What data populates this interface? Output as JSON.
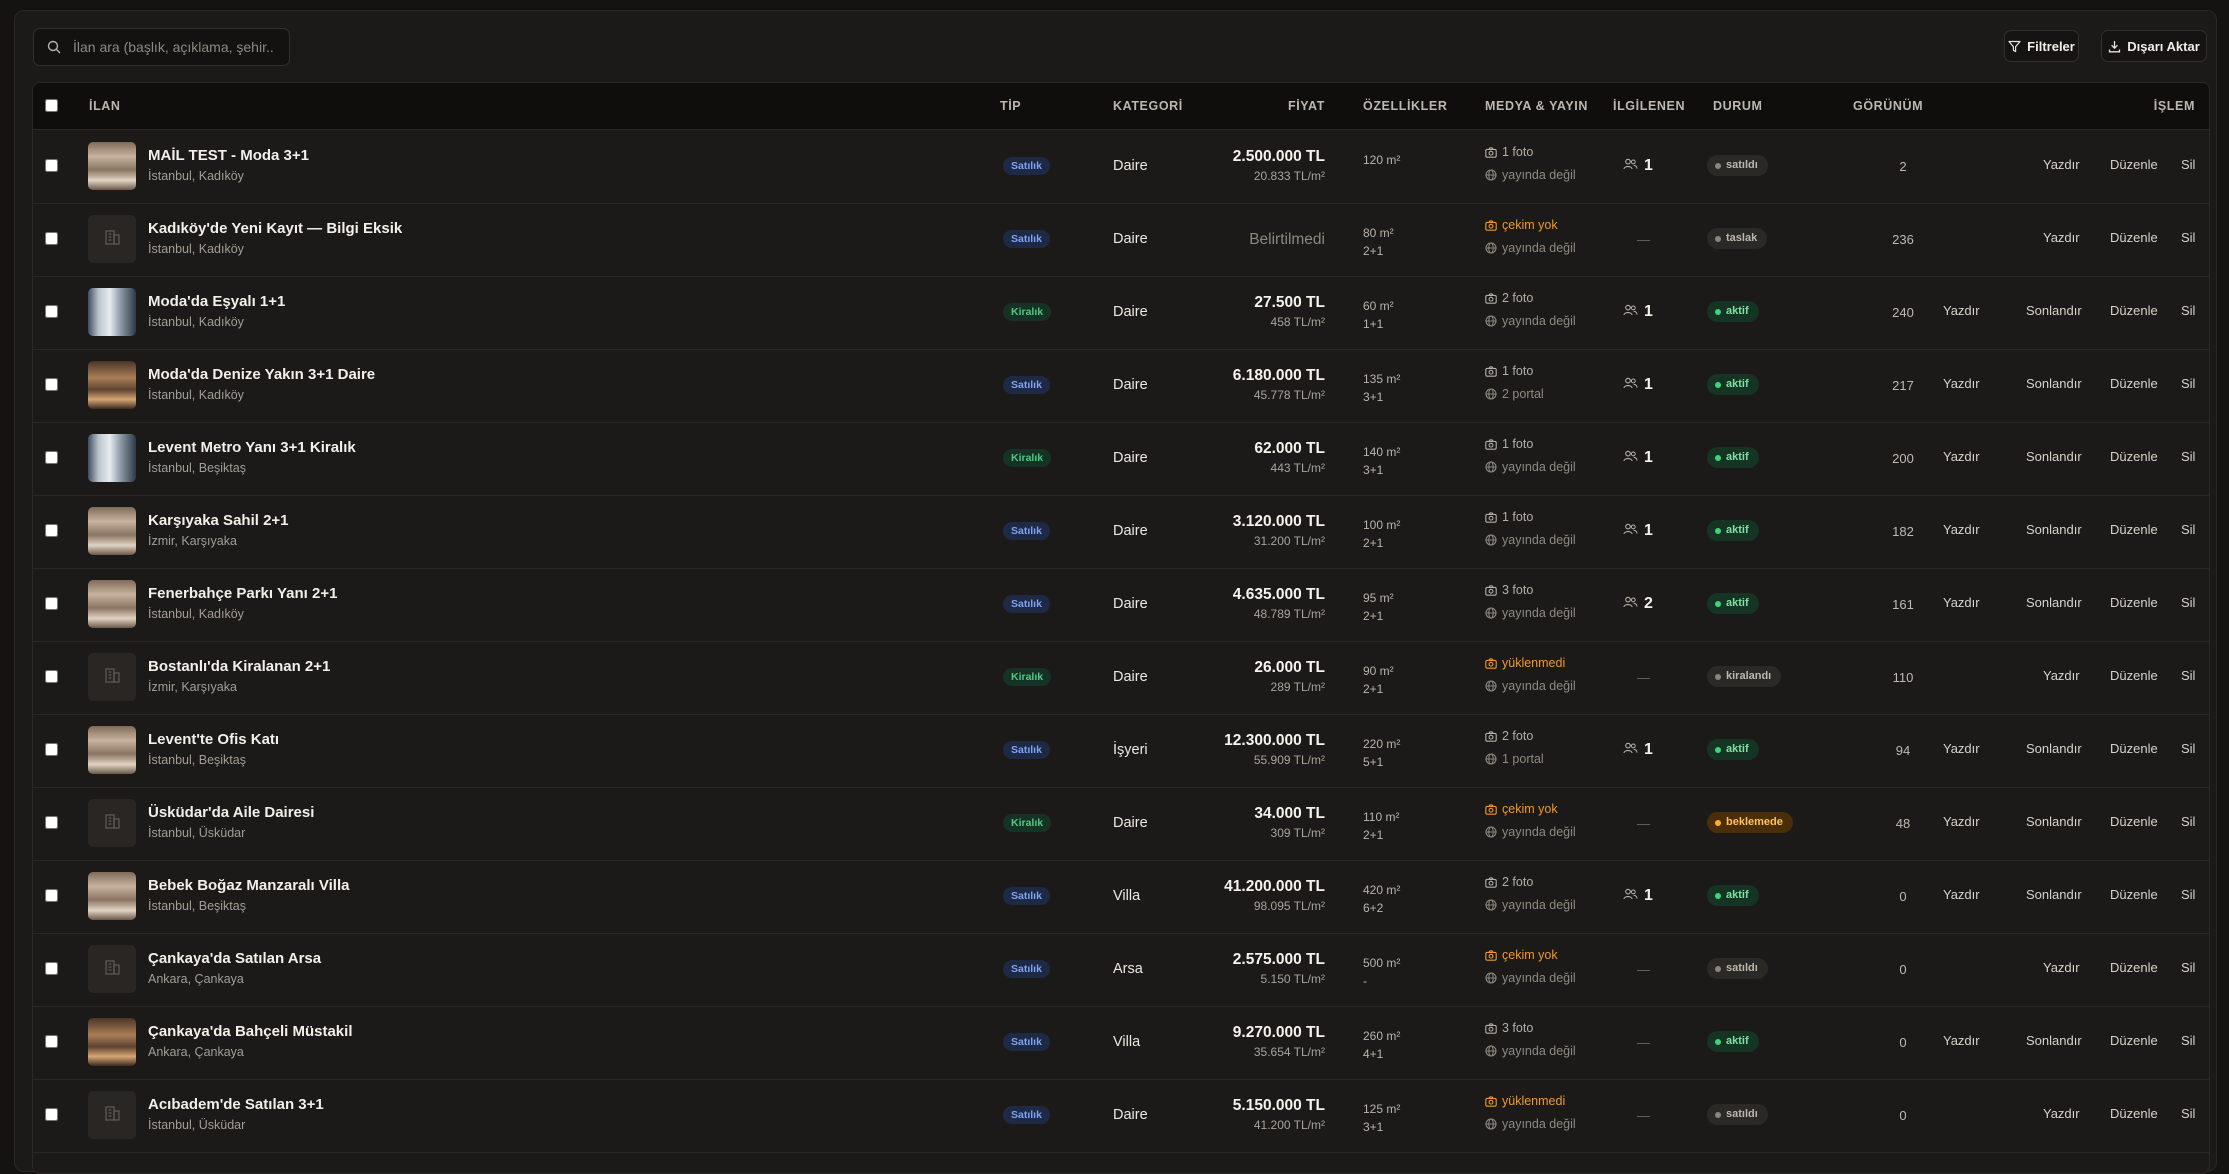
{
  "search": {
    "placeholder": "İlan ara (başlık, açıklama, şehir..."
  },
  "toolbar": {
    "filters_label": "Filtreler",
    "export_label": "Dışarı Aktar"
  },
  "columns": {
    "listing": "İLAN",
    "type": "TİP",
    "category": "KATEGORİ",
    "price": "FİYAT",
    "features": "ÖZELLİKLER",
    "media": "MEDYA & YAYIN",
    "interested": "İLGİLENEN",
    "status": "DURUM",
    "views": "GÖRÜNÜM",
    "action": "İŞLEM"
  },
  "actions": {
    "print": "Yazdır",
    "end": "Sonlandır",
    "edit": "Düzenle",
    "delete": "Sil"
  },
  "rows": [
    {
      "title": "MAİL TEST - Moda 3+1",
      "location": "İstanbul, Kadıköy",
      "thumb": "photo-living",
      "type": "Satılık",
      "category": "Daire",
      "price": "2.500.000 TL",
      "ppm": "20.833 TL/m²",
      "area": "120 m²",
      "rooms": "",
      "media": "1 foto",
      "media_warn": false,
      "publish": "yayında değil",
      "publish_icon": "globe",
      "interested": "1",
      "status": "satıldı",
      "status_kind": "gray",
      "views": "2",
      "can_end": false
    },
    {
      "title": "Kadıköy'de Yeni Kayıt — Bilgi Eksik",
      "location": "İstanbul, Kadıköy",
      "thumb": "empty",
      "type": "Satılık",
      "category": "Daire",
      "price": "Belirtilmedi",
      "ppm": "",
      "area": "80 m²",
      "rooms": "2+1",
      "media": "çekim yok",
      "media_warn": true,
      "publish": "yayında değil",
      "publish_icon": "globe",
      "interested": "",
      "status": "taslak",
      "status_kind": "gray",
      "views": "236",
      "can_end": false
    },
    {
      "title": "Moda'da Eşyalı 1+1",
      "location": "İstanbul, Kadıköy",
      "thumb": "photo-building",
      "type": "Kiralık",
      "category": "Daire",
      "price": "27.500 TL",
      "ppm": "458 TL/m²",
      "area": "60 m²",
      "rooms": "1+1",
      "media": "2 foto",
      "media_warn": false,
      "publish": "yayında değil",
      "publish_icon": "globe",
      "interested": "1",
      "status": "aktif",
      "status_kind": "aktif",
      "views": "240",
      "can_end": true
    },
    {
      "title": "Moda'da Denize Yakın 3+1 Daire",
      "location": "İstanbul, Kadıköy",
      "thumb": "photo-warm",
      "type": "Satılık",
      "category": "Daire",
      "price": "6.180.000 TL",
      "ppm": "45.778 TL/m²",
      "area": "135 m²",
      "rooms": "3+1",
      "media": "1 foto",
      "media_warn": false,
      "publish": "2 portal",
      "publish_icon": "globe",
      "interested": "1",
      "status": "aktif",
      "status_kind": "aktif",
      "views": "217",
      "can_end": true
    },
    {
      "title": "Levent Metro Yanı 3+1 Kiralık",
      "location": "İstanbul, Beşiktaş",
      "thumb": "photo-building",
      "type": "Kiralık",
      "category": "Daire",
      "price": "62.000 TL",
      "ppm": "443 TL/m²",
      "area": "140 m²",
      "rooms": "3+1",
      "media": "1 foto",
      "media_warn": false,
      "publish": "yayında değil",
      "publish_icon": "globe",
      "interested": "1",
      "status": "aktif",
      "status_kind": "aktif",
      "views": "200",
      "can_end": true
    },
    {
      "title": "Karşıyaka Sahil 2+1",
      "location": "İzmir, Karşıyaka",
      "thumb": "photo-living",
      "type": "Satılık",
      "category": "Daire",
      "price": "3.120.000 TL",
      "ppm": "31.200 TL/m²",
      "area": "100 m²",
      "rooms": "2+1",
      "media": "1 foto",
      "media_warn": false,
      "publish": "yayında değil",
      "publish_icon": "globe",
      "interested": "1",
      "status": "aktif",
      "status_kind": "aktif",
      "views": "182",
      "can_end": true
    },
    {
      "title": "Fenerbahçe Parkı Yanı 2+1",
      "location": "İstanbul, Kadıköy",
      "thumb": "photo-living",
      "type": "Satılık",
      "category": "Daire",
      "price": "4.635.000 TL",
      "ppm": "48.789 TL/m²",
      "area": "95 m²",
      "rooms": "2+1",
      "media": "3 foto",
      "media_warn": false,
      "publish": "yayında değil",
      "publish_icon": "globe",
      "interested": "2",
      "status": "aktif",
      "status_kind": "aktif",
      "views": "161",
      "can_end": true
    },
    {
      "title": "Bostanlı'da Kiralanan 2+1",
      "location": "İzmir, Karşıyaka",
      "thumb": "empty",
      "type": "Kiralık",
      "category": "Daire",
      "price": "26.000 TL",
      "ppm": "289 TL/m²",
      "area": "90 m²",
      "rooms": "2+1",
      "media": "yüklenmedi",
      "media_warn": true,
      "publish": "yayında değil",
      "publish_icon": "globe",
      "interested": "",
      "status": "kiralandı",
      "status_kind": "gray",
      "views": "110",
      "can_end": false
    },
    {
      "title": "Levent'te Ofis Katı",
      "location": "İstanbul, Beşiktaş",
      "thumb": "photo-living",
      "type": "Satılık",
      "category": "İşyeri",
      "price": "12.300.000 TL",
      "ppm": "55.909 TL/m²",
      "area": "220 m²",
      "rooms": "5+1",
      "media": "2 foto",
      "media_warn": false,
      "publish": "1 portal",
      "publish_icon": "globe",
      "interested": "1",
      "status": "aktif",
      "status_kind": "aktif",
      "views": "94",
      "can_end": true
    },
    {
      "title": "Üsküdar'da Aile Dairesi",
      "location": "İstanbul, Üsküdar",
      "thumb": "empty",
      "type": "Kiralık",
      "category": "Daire",
      "price": "34.000 TL",
      "ppm": "309 TL/m²",
      "area": "110 m²",
      "rooms": "2+1",
      "media": "çekim yok",
      "media_warn": true,
      "publish": "yayında değil",
      "publish_icon": "globe",
      "interested": "",
      "status": "beklemede",
      "status_kind": "warn",
      "views": "48",
      "can_end": true
    },
    {
      "title": "Bebek Boğaz Manzaralı Villa",
      "location": "İstanbul, Beşiktaş",
      "thumb": "photo-living",
      "type": "Satılık",
      "category": "Villa",
      "price": "41.200.000 TL",
      "ppm": "98.095 TL/m²",
      "area": "420 m²",
      "rooms": "6+2",
      "media": "2 foto",
      "media_warn": false,
      "publish": "yayında değil",
      "publish_icon": "globe",
      "interested": "1",
      "status": "aktif",
      "status_kind": "aktif",
      "views": "0",
      "can_end": true
    },
    {
      "title": "Çankaya'da Satılan Arsa",
      "location": "Ankara, Çankaya",
      "thumb": "empty",
      "type": "Satılık",
      "category": "Arsa",
      "price": "2.575.000 TL",
      "ppm": "5.150 TL/m²",
      "area": "500 m²",
      "rooms": "-",
      "media": "çekim yok",
      "media_warn": true,
      "publish": "yayında değil",
      "publish_icon": "globe",
      "interested": "",
      "status": "satıldı",
      "status_kind": "gray",
      "views": "0",
      "can_end": false
    },
    {
      "title": "Çankaya'da Bahçeli Müstakil",
      "location": "Ankara, Çankaya",
      "thumb": "photo-warm",
      "type": "Satılık",
      "category": "Villa",
      "price": "9.270.000 TL",
      "ppm": "35.654 TL/m²",
      "area": "260 m²",
      "rooms": "4+1",
      "media": "3 foto",
      "media_warn": false,
      "publish": "yayında değil",
      "publish_icon": "globe",
      "interested": "",
      "status": "aktif",
      "status_kind": "aktif",
      "views": "0",
      "can_end": true
    },
    {
      "title": "Acıbadem'de Satılan 3+1",
      "location": "İstanbul, Üsküdar",
      "thumb": "empty",
      "type": "Satılık",
      "category": "Daire",
      "price": "5.150.000 TL",
      "ppm": "41.200 TL/m²",
      "area": "125 m²",
      "rooms": "3+1",
      "media": "yüklenmedi",
      "media_warn": true,
      "publish": "yayında değil",
      "publish_icon": "globe",
      "interested": "",
      "status": "satıldı",
      "status_kind": "gray",
      "views": "0",
      "can_end": false
    }
  ],
  "colors": {
    "background": "#1c1a18",
    "header_bg": "#0f0e0d",
    "accent_warn": "#f0972d",
    "status_active": "#3fd37c",
    "badge_sale": "#7ea2f0",
    "badge_rent": "#4fc984"
  }
}
